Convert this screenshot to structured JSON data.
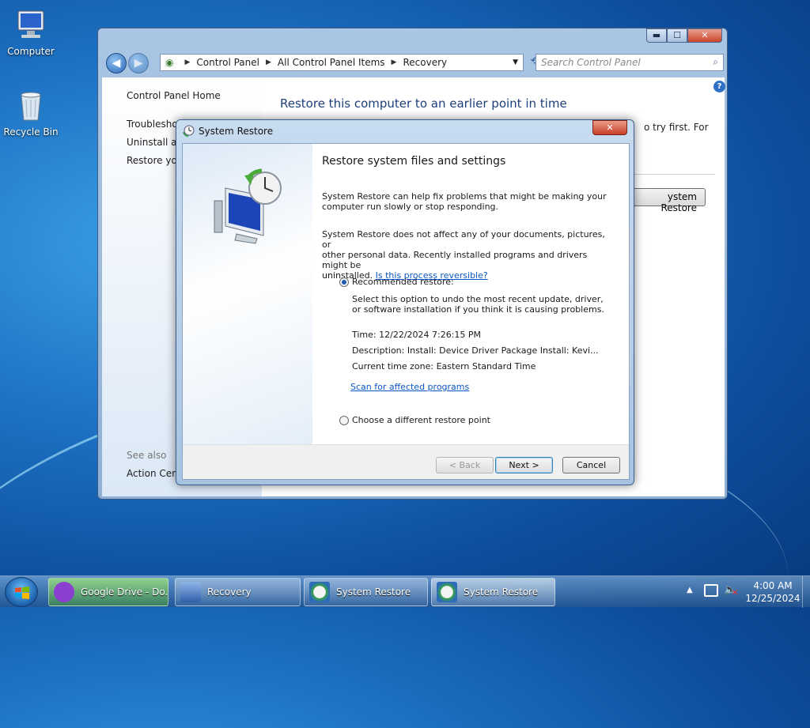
{
  "desktop": {
    "icons": [
      {
        "label": "Computer",
        "icon": "computer-icon"
      },
      {
        "label": "Recycle Bin",
        "icon": "recycle-bin-icon"
      }
    ]
  },
  "control_panel": {
    "breadcrumb": [
      "Control Panel",
      "All Control Panel Items",
      "Recovery"
    ],
    "search_placeholder": "Search Control Panel",
    "sidebar": {
      "home": "Control Panel Home",
      "items": [
        "Troubleshoo",
        "Uninstall a p",
        "Restore you"
      ],
      "see_also": "See also",
      "action_center": "Action Cent"
    },
    "title": "Restore this computer to an earlier point in time",
    "partial_text": "o try first. For",
    "open_button": "ystem Restore",
    "caption": {
      "minimize": "▬",
      "maximize": "☐",
      "close": "✕"
    }
  },
  "system_restore": {
    "title": "System Restore",
    "heading": "Restore system files and settings",
    "para1": [
      "System Restore can help fix problems that might be making your",
      "computer run slowly or stop responding."
    ],
    "para2": [
      "System Restore does not affect any of your documents, pictures, or",
      "other personal data. Recently installed programs and drivers might be",
      "uninstalled."
    ],
    "reversible_link": "Is this process reversible?",
    "recommended_label": "Recommended restore:",
    "recommended_desc": [
      "Select this option to undo the most recent update, driver,",
      "or software installation if you think it is causing problems."
    ],
    "time": "Time: 12/22/2024 7:26:15 PM",
    "description": "Description: Install: Device Driver Package Install: Kevi...",
    "timezone": "Current time zone: Eastern Standard Time",
    "scan_link": "Scan for affected programs",
    "different_label": "Choose a different restore point",
    "selected_option": "recommended",
    "buttons": {
      "back": "< Back",
      "next": "Next >",
      "cancel": "Cancel"
    }
  },
  "taskbar": {
    "items": [
      {
        "label": "Google Drive - Do...",
        "icon": "google-drive-icon",
        "active": false
      },
      {
        "label": "Recovery",
        "icon": "control-panel-icon",
        "active": false
      },
      {
        "label": "System Restore",
        "icon": "system-restore-icon",
        "active": false
      },
      {
        "label": "System Restore",
        "icon": "system-restore-icon",
        "active": true
      }
    ],
    "clock_time": "4:00 AM",
    "clock_date": "12/25/2024"
  }
}
